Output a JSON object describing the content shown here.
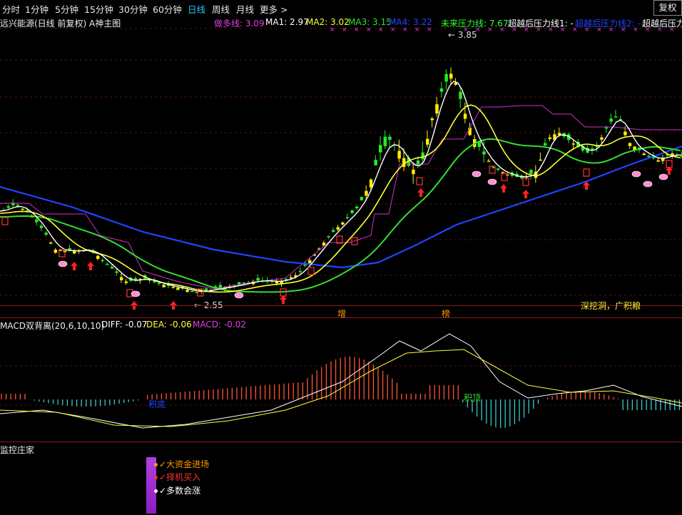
{
  "toolbar": {
    "tabs": [
      "分时",
      "1分钟",
      "5分钟",
      "15分钟",
      "30分钟",
      "60分钟",
      "日线",
      "周线",
      "月线",
      "更多 >"
    ],
    "active_tab": "日线",
    "fuquan_label": "复权"
  },
  "main_chart": {
    "title": "远兴能源(日线 前复权) A神主图",
    "indicators": [
      {
        "label": "做多线: 3.09",
        "color": "#e040e0"
      },
      {
        "label": "MA1: 2.97",
        "color": "#ffffff"
      },
      {
        "label": "MA2: 3.02",
        "color": "#ffff33"
      },
      {
        "label": "MA3: 3.15",
        "color": "#33dd33"
      },
      {
        "label": "MA4: 3.22",
        "color": "#2244ff"
      },
      {
        "label": "未来压力线: 7.67",
        "color": "#33ff33"
      },
      {
        "label": "超越后压力线1: -",
        "color": "#ffffff"
      },
      {
        "label": "超越后压力线2: -",
        "color": "#2244ff"
      },
      {
        "label": "超越后压力",
        "color": "#ffffff"
      }
    ],
    "high_label": "3.85",
    "low_label": "2.55",
    "marker_zeng": "增",
    "marker_bang": "榜",
    "slogan": "深挖洞，广积粮"
  },
  "macd_panel": {
    "title": "MACD双背离(20,6,10,10)",
    "diff_label": "DIFF: -0.07",
    "dea_label": "DEA: -0.06",
    "macd_label": "MACD: -0.02",
    "annotation_left": "积底",
    "annotation_right": "积顶"
  },
  "monitor_panel": {
    "title": "监控庄家",
    "signals": [
      {
        "label": "大资金进场",
        "color": "#ff9900"
      },
      {
        "label": "择机买入",
        "color": "#ff3333"
      },
      {
        "label": "多数会涨",
        "color": "#ffffff"
      }
    ]
  },
  "colors": {
    "up_candle": "#ffee00",
    "down_candle": "#22ee22",
    "ma1": "#ffffff",
    "ma2": "#ffff33",
    "ma3": "#33dd33",
    "ma4": "#2244ff",
    "pressure": "#cc33cc",
    "macd_pos": "#ff5533",
    "macd_neg": "#33cccc"
  }
}
